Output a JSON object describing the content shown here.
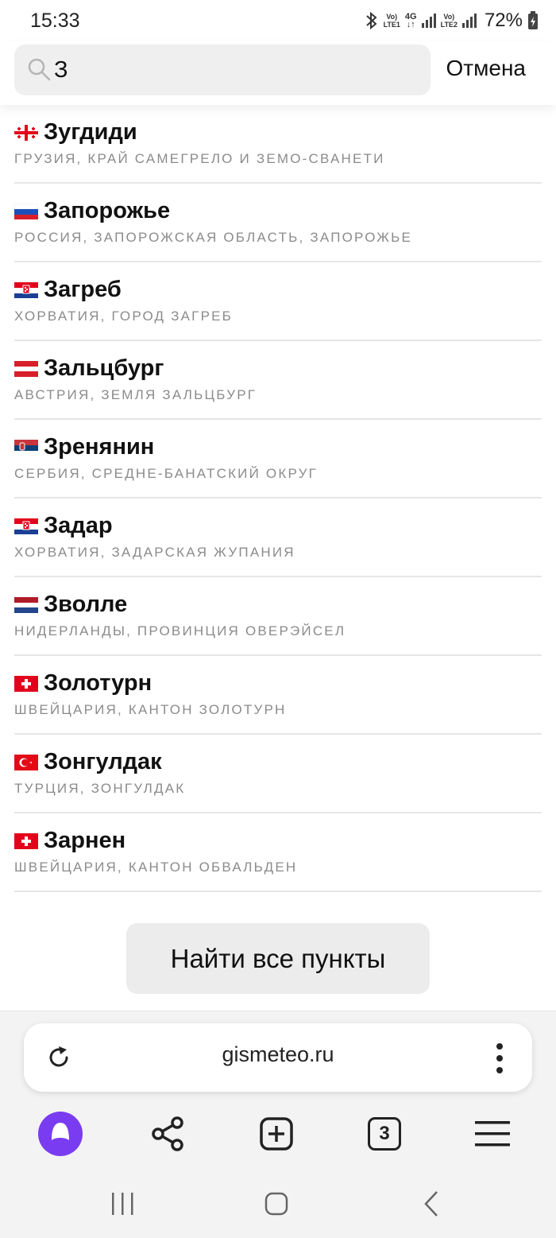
{
  "status_bar": {
    "time": "15:33",
    "sim1_top": "Vo)",
    "sim1_bottom": "LTE1",
    "net_top": "4G",
    "net_bottom": "↓↑",
    "sim2_top": "Vo)",
    "sim2_bottom": "LTE2",
    "battery": "72%"
  },
  "search": {
    "value": "З",
    "cancel_label": "Отмена"
  },
  "results": [
    {
      "flag": "georgia",
      "city": "Зугдиди",
      "region": "Грузия, Край Самегрело и Земо-Сванети"
    },
    {
      "flag": "russia",
      "city": "Запорожье",
      "region": "Россия, Запорожская область, Запорожье"
    },
    {
      "flag": "croatia",
      "city": "Загреб",
      "region": "Хорватия, Город Загреб"
    },
    {
      "flag": "austria",
      "city": "Зальцбург",
      "region": "Австрия, Земля Зальцбург"
    },
    {
      "flag": "serbia",
      "city": "Зренянин",
      "region": "Сербия, Средне-Банатский округ"
    },
    {
      "flag": "croatia",
      "city": "Задар",
      "region": "Хорватия, Задарская жупания"
    },
    {
      "flag": "netherlands",
      "city": "Зволле",
      "region": "Нидерланды, провинция Оверэйсел"
    },
    {
      "flag": "switzerland",
      "city": "Золотурн",
      "region": "Швейцария, Кантон Золотурн"
    },
    {
      "flag": "turkey",
      "city": "Зонгулдак",
      "region": "Турция, Зонгулдак"
    },
    {
      "flag": "switzerland",
      "city": "Зарнен",
      "region": "Швейцария, Кантон Обвальден"
    }
  ],
  "find_all_label": "Найти все пункты",
  "browser": {
    "url": "gismeteo.ru",
    "tab_count": "3",
    "accent": "#7a3cf0"
  },
  "icons": [
    "search-icon",
    "reload-icon",
    "more-vert-icon",
    "alice-icon",
    "share-icon",
    "new-tab-icon",
    "tabs-icon",
    "menu-icon",
    "recents-icon",
    "home-icon",
    "back-icon"
  ]
}
